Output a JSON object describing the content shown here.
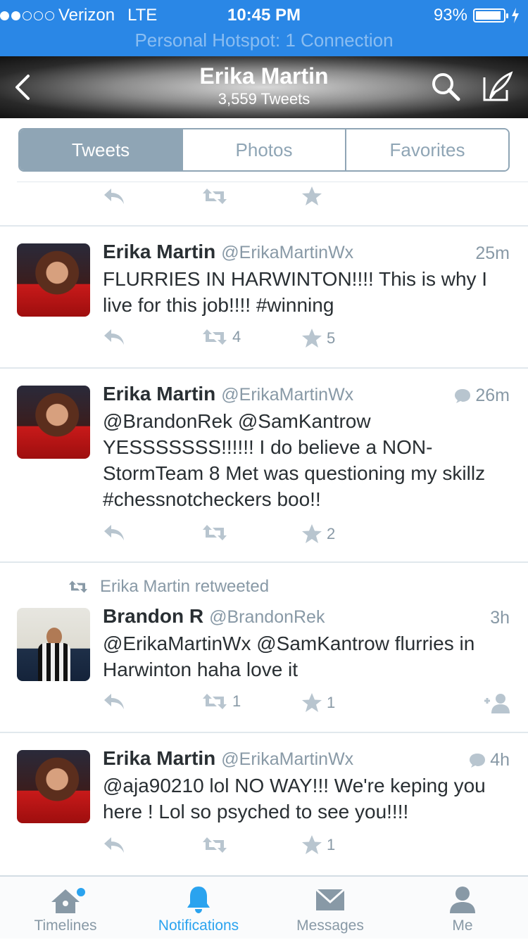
{
  "status_bar": {
    "carrier": "Verizon",
    "network": "LTE",
    "time": "10:45 PM",
    "battery": "93%",
    "battery_level": 0.93,
    "hotspot": "Personal Hotspot: 1 Connection"
  },
  "header": {
    "title": "Erika Martin",
    "subtitle": "3,559 Tweets"
  },
  "segments": [
    {
      "label": "Tweets",
      "active": true
    },
    {
      "label": "Photos",
      "active": false
    },
    {
      "label": "Favorites",
      "active": false
    }
  ],
  "tweets": [
    {
      "name": "Erika Martin",
      "handle": "@ErikaMartinWx",
      "time": "25m",
      "text": "FLURRIES IN HARWINTON!!!! This is why I live for this job!!!! #winning",
      "retweets": "4",
      "favorites": "5"
    },
    {
      "name": "Erika Martin",
      "handle": "@ErikaMartinWx",
      "time": "26m",
      "text": "@BrandonRek @SamKantrow YESSSSSSS!!!!!! I do believe a NON-StormTeam 8 Met was questioning my skillz #chessnotcheckers boo!!",
      "retweets": "",
      "favorites": "2"
    },
    {
      "retweeted_by": "Erika Martin retweeted",
      "name": "Brandon R",
      "handle": "@BrandonRek",
      "time": "3h",
      "text": "@ErikaMartinWx @SamKantrow  flurries in Harwinton haha love it",
      "retweets": "1",
      "favorites": "1"
    },
    {
      "name": "Erika Martin",
      "handle": "@ErikaMartinWx",
      "time": "4h",
      "text": "@aja90210 lol NO WAY!!! We're keping you here ! Lol so psyched to see you!!!!",
      "retweets": "",
      "favorites": "1"
    }
  ],
  "tab_bar": [
    {
      "label": "Timelines",
      "icon": "home-icon"
    },
    {
      "label": "Notifications",
      "icon": "bell-icon",
      "active": true
    },
    {
      "label": "Messages",
      "icon": "envelope-icon"
    },
    {
      "label": "Me",
      "icon": "person-icon"
    }
  ],
  "colors": {
    "status_bar": "#2a87e6",
    "accent": "#2aa3ef",
    "muted": "#8899a6",
    "segment": "#8fa5b5"
  }
}
